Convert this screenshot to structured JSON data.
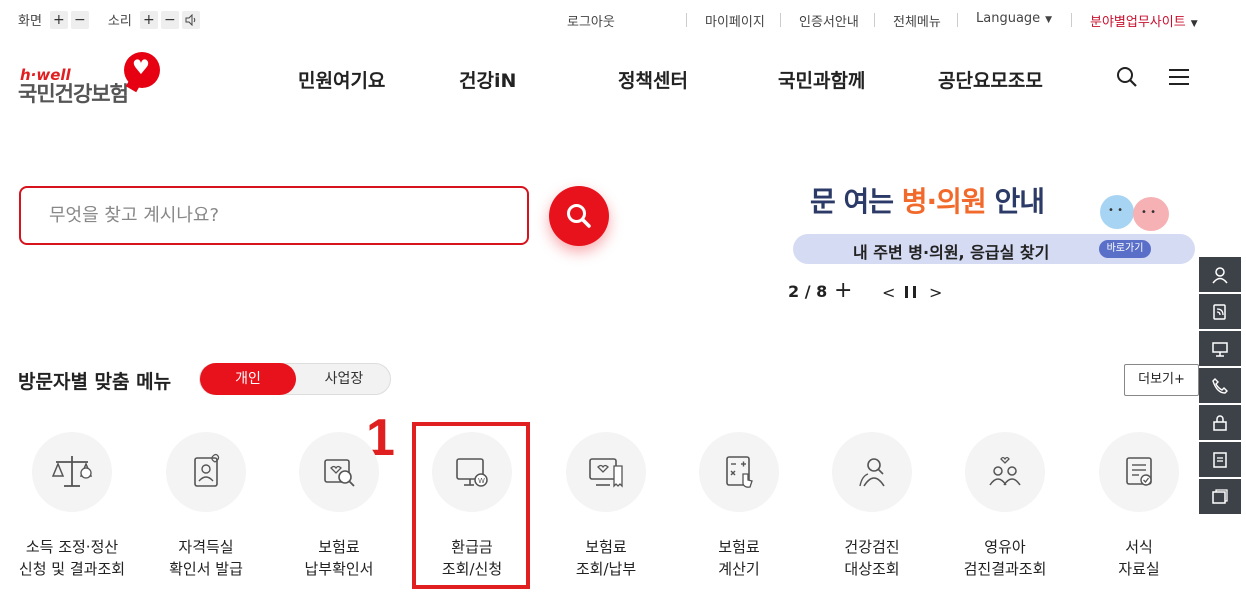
{
  "util": {
    "screen_label": "화면",
    "sound_label": "소리",
    "plus": "+",
    "minus": "−",
    "links": [
      "로그아웃",
      "마이페이지",
      "인증서안내",
      "전체메뉴",
      "Language"
    ],
    "site_select": "분야별업무사이트"
  },
  "logo": {
    "sub": "h·well",
    "main": "국민건강보험"
  },
  "gnb": [
    "민원여기요",
    "건강iN",
    "정책센터",
    "국민과함께",
    "공단요모조모"
  ],
  "search": {
    "placeholder": "무엇을 찾고 계시나요?"
  },
  "banner": {
    "title_pre": "문 여는 ",
    "title_hl": "병·의원",
    "title_post": " 안내",
    "pill": "내 주변 병·의원, 응급실 찾기",
    "go": "바로가기",
    "pager": "2 / 8"
  },
  "visitor": {
    "title": "방문자별 맞춤 메뉴",
    "tab_personal": "개인",
    "tab_business": "사업장",
    "more": "더보기+",
    "marker": "1",
    "tiles": [
      {
        "l1": "소득 조정·정산",
        "l2": "신청 및 결과조회",
        "icon": "scale-icon"
      },
      {
        "l1": "자격득실",
        "l2": "확인서 발급",
        "icon": "id-card-icon"
      },
      {
        "l1": "보험료",
        "l2": "납부확인서",
        "icon": "payment-check-icon"
      },
      {
        "l1": "환급금",
        "l2": "조회/신청",
        "icon": "refund-monitor-icon"
      },
      {
        "l1": "보험료",
        "l2": "조회/납부",
        "icon": "bill-icon"
      },
      {
        "l1": "보험료",
        "l2": "계산기",
        "icon": "calculator-icon"
      },
      {
        "l1": "건강검진",
        "l2": "대상조회",
        "icon": "checkup-person-icon"
      },
      {
        "l1": "영유아",
        "l2": "검진결과조회",
        "icon": "family-icon"
      },
      {
        "l1": "서식",
        "l2": "자료실",
        "icon": "document-icon"
      }
    ]
  },
  "colors": {
    "brand_red": "#e8121c",
    "quick_bar": "#3d4148",
    "banner_navy": "#2b3a67",
    "banner_orange": "#f26a2b"
  }
}
